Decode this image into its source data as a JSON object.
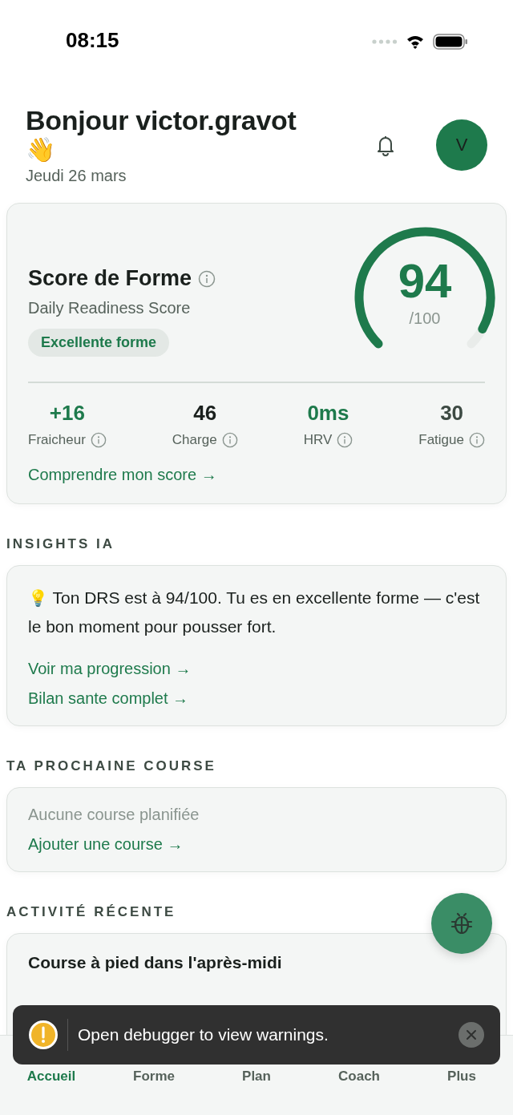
{
  "status_bar": {
    "time": "08:15"
  },
  "header": {
    "greeting": "Bonjour victor.gravot",
    "emoji": "👋",
    "date": "Jeudi 26 mars",
    "avatar": "V"
  },
  "score_card": {
    "title": "Score de Forme",
    "subtitle": "Daily Readiness Score",
    "badge": "Excellente forme",
    "score": "94",
    "max": "/100",
    "metrics": [
      {
        "value": "+16",
        "label": "Fraicheur",
        "color": "#1e7a4c"
      },
      {
        "value": "46",
        "label": "Charge",
        "color": "#1a201d"
      },
      {
        "value": "0ms",
        "label": "HRV",
        "color": "#1e7a4c"
      },
      {
        "value": "30",
        "label": "Fatigue",
        "color": "#3d4a43"
      }
    ],
    "link": "Comprendre mon score →"
  },
  "insights": {
    "heading": "INSIGHTS IA",
    "icon": "💡",
    "text": "Ton DRS est à 94/100. Tu es en excellente forme — c'est le bon moment pour pousser fort.",
    "links": [
      "Voir ma progression →",
      "Bilan sante complet →"
    ]
  },
  "next_race": {
    "heading": "TA PROCHAINE COURSE",
    "empty": "Aucune course planifiée",
    "link": "Ajouter une course →"
  },
  "recent": {
    "heading": "ACTIVITÉ RÉCENTE",
    "title": "Course à pied dans l'après-midi"
  },
  "toast": {
    "text": "Open debugger to view warnings."
  },
  "tabs": [
    {
      "label": "Accueil",
      "selected": true
    },
    {
      "label": "Forme",
      "selected": false
    },
    {
      "label": "Plan",
      "selected": false
    },
    {
      "label": "Coach",
      "selected": false
    },
    {
      "label": "Plus",
      "selected": false
    }
  ]
}
